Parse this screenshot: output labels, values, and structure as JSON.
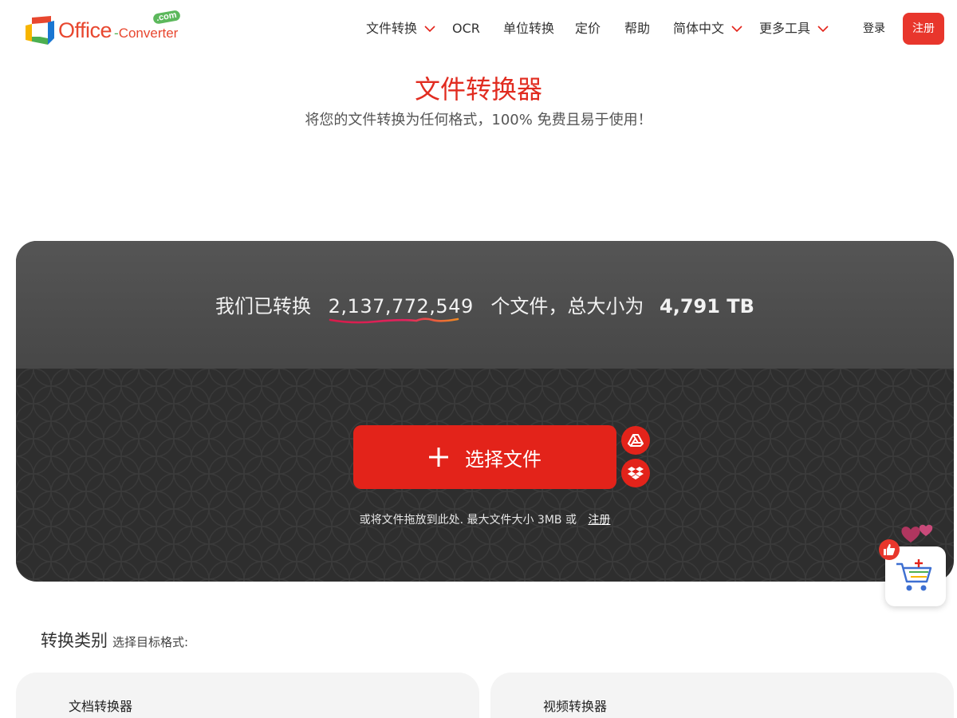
{
  "header": {
    "logo": {
      "word1": "Office",
      "dash": "-",
      "word2": "Converter",
      "badge": ".com"
    },
    "nav": [
      {
        "label": "文件转换",
        "dropdown": true
      },
      {
        "label": "OCR",
        "dropdown": false
      },
      {
        "label": "单位转换",
        "dropdown": false
      },
      {
        "label": "定价",
        "dropdown": false
      },
      {
        "label": "帮助",
        "dropdown": false
      },
      {
        "label": "简体中文",
        "dropdown": true
      },
      {
        "label": "更多工具",
        "dropdown": true
      }
    ],
    "login_label": "登录",
    "signup_label": "注册"
  },
  "hero": {
    "title": "文件转换器",
    "subtitle": "将您的文件转换为任何格式，100% 免费且易于使用！"
  },
  "converter": {
    "stats_prefix": "我们已转换",
    "files_count": "2,137,772,549",
    "stats_middle": "个文件，总大小为",
    "total_size": "4,791 TB",
    "choose_label": "选择文件",
    "drop_hint": "或将文件拖放到此处. 最大文件大小 3MB 或",
    "register_link": "注册",
    "cloud_icons": [
      "google-drive-icon",
      "dropbox-icon"
    ]
  },
  "categories": {
    "title": "转换类别",
    "subtitle": "选择目标格式:",
    "cards": [
      "文档转换器",
      "视频转换器"
    ]
  },
  "colors": {
    "accent": "#e3231a",
    "panel_top": "#505050",
    "panel_body": "#2e2e2e",
    "card_bg": "#f4f4f4"
  }
}
